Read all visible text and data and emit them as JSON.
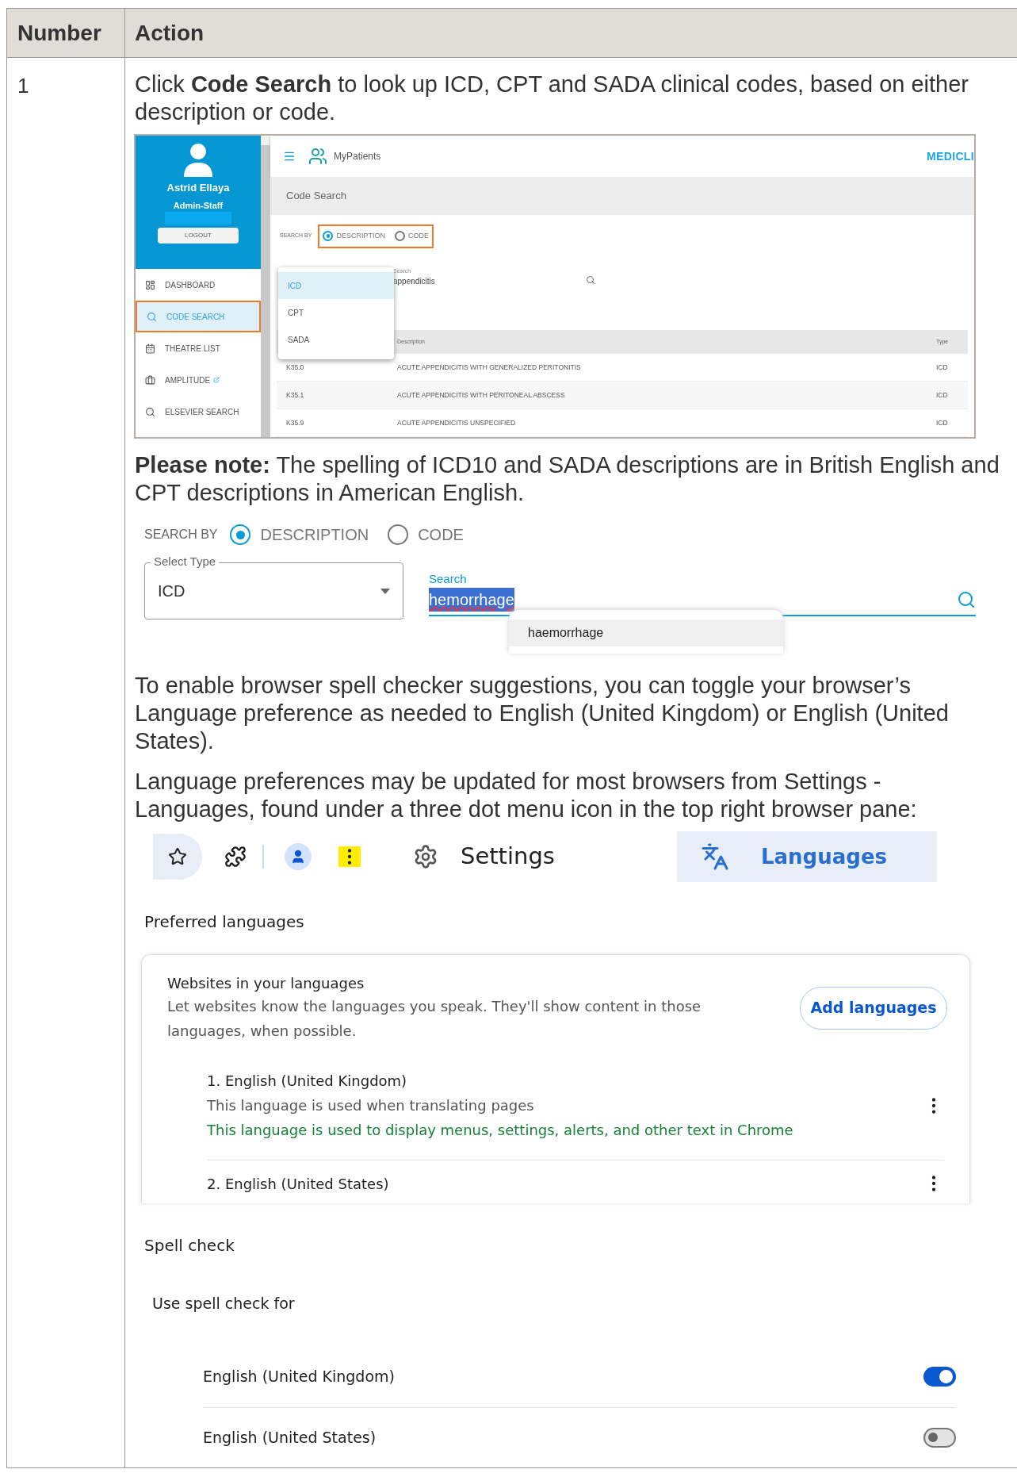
{
  "table": {
    "columns": [
      "Number",
      "Action"
    ],
    "rows": [
      {
        "number": "1",
        "intro": "Click **Code Search** to look up ICD, CPT and SADA clinical codes, based on either description or code.",
        "app_screenshot": {
          "user": {
            "name": "Astrid Ellaya",
            "role": "Admin-Staff",
            "logout": "LOGOUT"
          },
          "nav": [
            {
              "label": "DASHBOARD",
              "selected": false,
              "external": false
            },
            {
              "label": "CODE SEARCH",
              "selected": true,
              "external": false
            },
            {
              "label": "THEATRE LIST",
              "selected": false,
              "external": false
            },
            {
              "label": "AMPLITUDE",
              "selected": false,
              "external": true
            },
            {
              "label": "ELSEVIER SEARCH",
              "selected": false,
              "external": false
            }
          ],
          "app_name": "MyPatients",
          "brand": "MEDICLI",
          "page_title": "Code Search",
          "search_by": "SEARCH BY",
          "options": [
            {
              "label": "DESCRIPTION",
              "selected": true
            },
            {
              "label": "CODE",
              "selected": false
            }
          ],
          "type_options": [
            {
              "label": "ICD",
              "selected": true
            },
            {
              "label": "CPT",
              "selected": false
            },
            {
              "label": "SADA",
              "selected": false
            }
          ],
          "search": {
            "label": "Search",
            "value": "appendicitis"
          },
          "columns": [
            "Description",
            "Type"
          ],
          "rows": [
            {
              "code": "K35.0",
              "description": "ACUTE APPENDICITIS WITH GENERALIZED PERITONITIS",
              "type": "ICD"
            },
            {
              "code": "K35.1",
              "description": "ACUTE APPENDICITIS WITH PERITONEAL ABSCESS",
              "type": "ICD"
            },
            {
              "code": "K35.9",
              "description": "ACUTE APPENDICITIS UNSPECIFIED",
              "type": "ICD"
            }
          ]
        },
        "note": "**Please note:** The spelling of ICD10 and SADA descriptions are in British English and CPT descriptions in American English.",
        "search_screenshot": {
          "search_by": "SEARCH BY",
          "options": [
            {
              "label": "DESCRIPTION",
              "selected": true
            },
            {
              "label": "CODE",
              "selected": false
            }
          ],
          "select": {
            "label": "Select Type",
            "value": "ICD"
          },
          "search": {
            "label": "Search",
            "value": "hemorrhage"
          },
          "suggestion": "haemorrhage"
        },
        "paragraphs": [
          "To enable browser spell checker suggestions, you can toggle your browser’s Language preference as needed to English (United Kingdom) or English (United States).",
          "Language preferences may be updated for most browsers from Settings  - Languages, found under a three dot menu icon in the top right browser pane:"
        ],
        "browser_screenshot": {
          "settings": "Settings",
          "languages_tab": "Languages",
          "section": "Preferred languages",
          "card": {
            "title": "Websites in your languages",
            "description": "Let websites know the languages you speak. They'll show content in those languages, when possible.",
            "button": "Add languages",
            "languages": [
              {
                "name": "1. English (United Kingdom)",
                "lines": [
                  {
                    "kind": "note",
                    "text": "This language is used when translating pages"
                  },
                  {
                    "kind": "display",
                    "text": "This language is used to display menus, settings, alerts, and other text in Chrome"
                  }
                ]
              },
              {
                "name": "2. English (United States)"
              }
            ]
          },
          "spell_heading": "Spell check",
          "spell_sub": "Use spell check for",
          "spell": [
            {
              "label": "English (United Kingdom)",
              "on": true
            },
            {
              "label": "English (United States)",
              "on": false
            }
          ]
        }
      }
    ]
  }
}
